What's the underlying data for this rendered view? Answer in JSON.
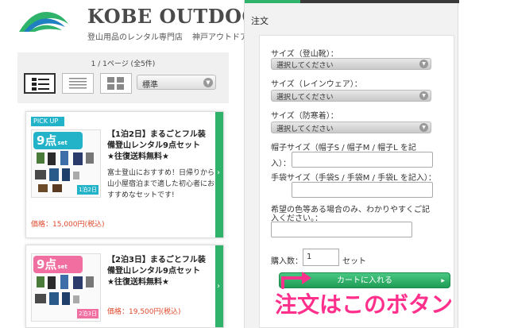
{
  "brand": {
    "name": "KOBE OUTDOOR",
    "tagline": "登山用品のレンタル専門店",
    "tagline_kana": "神戸アウトドア",
    "colors": {
      "green": "#2fb36a",
      "blue": "#1f7fc1"
    }
  },
  "listing": {
    "page_count": "1 / 1ページ (全5件)",
    "view_buttons": [
      "list-view-icon",
      "detail-view-icon",
      "grid-view-icon"
    ],
    "sort_value": "標準"
  },
  "products": [
    {
      "pickup": "PICK UP",
      "badge": "9点",
      "badge_suffix": "set",
      "badge_color": "#22b3c9",
      "tag": "1泊2日",
      "title": "【1泊2日】まるごとフル装備登山レンタル9点セット　★往復送料無料★",
      "desc": "富士登山におすすめ！日帰りから山小屋宿泊まで適した初心者におすすめなセットです!",
      "price": "価格：15,000円(税込)"
    },
    {
      "pickup": "",
      "badge": "9点",
      "badge_suffix": "set",
      "badge_color": "#f06ea0",
      "tag": "2泊3日",
      "title": "【2泊3日】まるごとフル装備登山レンタル9点セット　★往復送料無料★",
      "desc": "",
      "price": "価格：19,500円(税込)"
    }
  ],
  "order": {
    "title": "注文",
    "fields": {
      "size_boots_label": "サイズ（登山靴）：",
      "size_boots_value": "選択してください",
      "size_rain_label": "サイズ（レインウェア）：",
      "size_rain_value": "選択してください",
      "size_cold_label": "サイズ（防寒着）：",
      "size_cold_value": "選択してください",
      "hat_label_1": "帽子サイズ（帽子S / 帽子M / 帽子L を記",
      "hat_label_2": "入）：",
      "glove_label": "手袋サイズ（手袋S / 手袋M / 手袋L を記入）：",
      "color_label_1": "希望の色等ある場合のみ、わかりやすくご記",
      "color_label_2": "入ください。：",
      "qty_label": "購入数：",
      "qty_value": "1",
      "qty_unit": "セット"
    },
    "cart_button": "カートに入れる"
  },
  "annotation": {
    "text": "注文はこのボタン",
    "color": "#ff2f8c"
  }
}
